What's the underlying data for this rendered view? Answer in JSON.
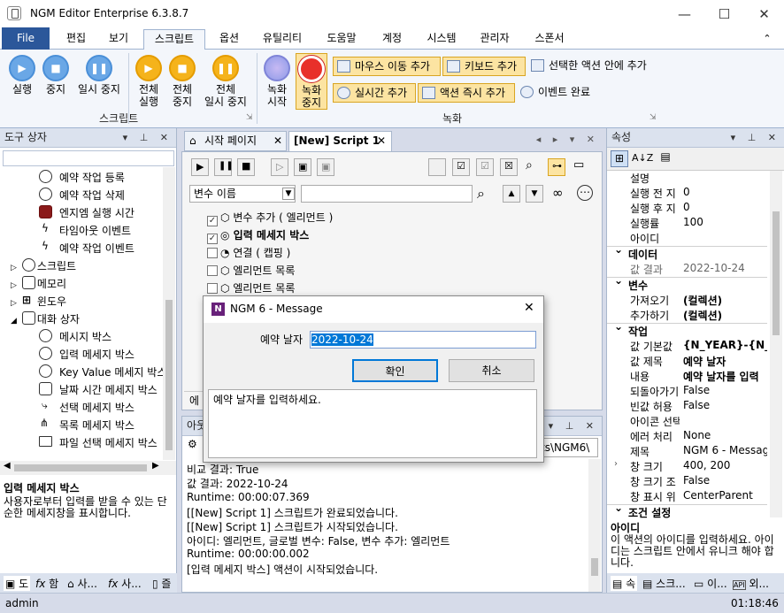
{
  "window": {
    "title": "NGM Editor  Enterprise 6.3.8.7",
    "minimize": "—",
    "maximize": "☐",
    "close": "✕"
  },
  "menu": {
    "file": "File",
    "tabs": [
      "편집",
      "보기",
      "스크립트",
      "옵션",
      "유틸리티",
      "도움말",
      "계정",
      "시스템",
      "관리자",
      "스폰서"
    ]
  },
  "ribbon": {
    "run": "실행",
    "stop": "중지",
    "pause": "일시 중지",
    "run_all_1": "전체",
    "run_all_2": "실행",
    "stop_all_1": "전체",
    "stop_all_2": "중지",
    "pause_all_1": "전체",
    "pause_all_2": "일시 중지",
    "group_script": "스크립트",
    "rec_start_1": "녹화",
    "rec_start_2": "시작",
    "rec_stop_1": "녹화",
    "rec_stop_2": "중지",
    "mouse_add": "마우스 이동 추가",
    "key_add": "키보드 추가",
    "add_in_action": "선택한 액션 안에 추가",
    "realtime_add": "실시간 추가",
    "action_now_add": "액션 즉시 추가",
    "event_done": "이벤트 완료",
    "group_rec": "녹화"
  },
  "toolbox": {
    "title": "도구 상자",
    "items": [
      "예약 작업 등록",
      "예약 작업 삭제",
      "엔지엠 실행 시간",
      "타임아웃 이벤트",
      "예약 작업 이벤트",
      "스크립트",
      "메모리",
      "윈도우",
      "대화 상자",
      "메시지 박스",
      "입력 메세지 박스",
      "Key Value 메세지 박스",
      "날짜 시간 메세지 박스",
      "선택 메세지 박스",
      "목록 메세지 박스",
      "파일 선택 메세지 박스"
    ],
    "desc_title": "입력 메세지 박스",
    "desc_text": "사용자로부터 입력를 받을 수 있는 단순한 메세지창을 표시합니다.",
    "bottom_tabs": [
      "도",
      "함",
      "사...",
      "사...",
      "즐"
    ]
  },
  "editor": {
    "tab_start": "시작 페이지",
    "tab_script": "[New] Script 1",
    "var_select": "변수 이름",
    "rows": [
      "변수 추가 ( 엘리먼트 )",
      "입력 메세지 박스",
      "연결 ( 캡핑 )",
      "엘리먼트 목록",
      "엘리먼트 목록"
    ],
    "lower_label": "에"
  },
  "output": {
    "title": "아웃",
    "path": "ts\\NGM6\\",
    "lines": [
      "비교 결과: True",
      "값 결과: 2022-10-24",
      "Runtime: 00:00:07.369",
      "[[New] Script 1] 스크립트가 완료되었습니다.",
      "[[New] Script 1] 스크립트가 시작되었습니다.",
      "아이디: 엘리먼트, 글로벌 변수: False, 변수 추가: 엘리먼트",
      "Runtime: 00:00:00.002",
      "[입력 메세지 박스] 액션이 시작되었습니다."
    ]
  },
  "props": {
    "title": "속성",
    "top": [
      [
        "설명",
        ""
      ],
      [
        "실행 전 지",
        "0"
      ],
      [
        "실행 후 지",
        "0"
      ],
      [
        "실행률",
        "100"
      ],
      [
        "아이디",
        ""
      ]
    ],
    "sec_data": "데이터",
    "data": [
      [
        "값 결과",
        "2022-10-24"
      ]
    ],
    "sec_var": "변수",
    "var": [
      [
        "가져오기",
        "(컬렉션)"
      ],
      [
        "추가하기",
        "(컬렉션)"
      ]
    ],
    "sec_work": "작업",
    "work": [
      [
        "값 기본값",
        "{N_YEAR}-{N_"
      ],
      [
        "값 제목",
        "예약 날자"
      ],
      [
        "내용",
        "예약 날자를 입력"
      ],
      [
        "되돌아가기",
        "False"
      ],
      [
        "빈값 허용",
        "False"
      ],
      [
        "아이콘 선택",
        ""
      ],
      [
        "에러 처리",
        "None"
      ],
      [
        "제목",
        "NGM 6 - Messag"
      ],
      [
        "창 크기",
        "400, 200"
      ],
      [
        "창 크기 조",
        "False"
      ],
      [
        "창 표시 위",
        "CenterParent"
      ]
    ],
    "sec_cond": "조건 설정",
    "desc_title": "아이디",
    "desc_text": "이 액션의 아이디를 입력하세요. 아이디는 스크립트 안에서 유니크 해야 합니다.",
    "bottom_tabs": [
      "속",
      "스크...",
      "이...",
      "외..."
    ]
  },
  "dialog": {
    "title": "NGM 6 - Message",
    "label": "예약 날자",
    "value": "2022-10-24",
    "ok": "확인",
    "cancel": "취소",
    "message": "예약 날자를 입력하세요."
  },
  "status": {
    "user": "admin",
    "time": "01:18:46"
  }
}
